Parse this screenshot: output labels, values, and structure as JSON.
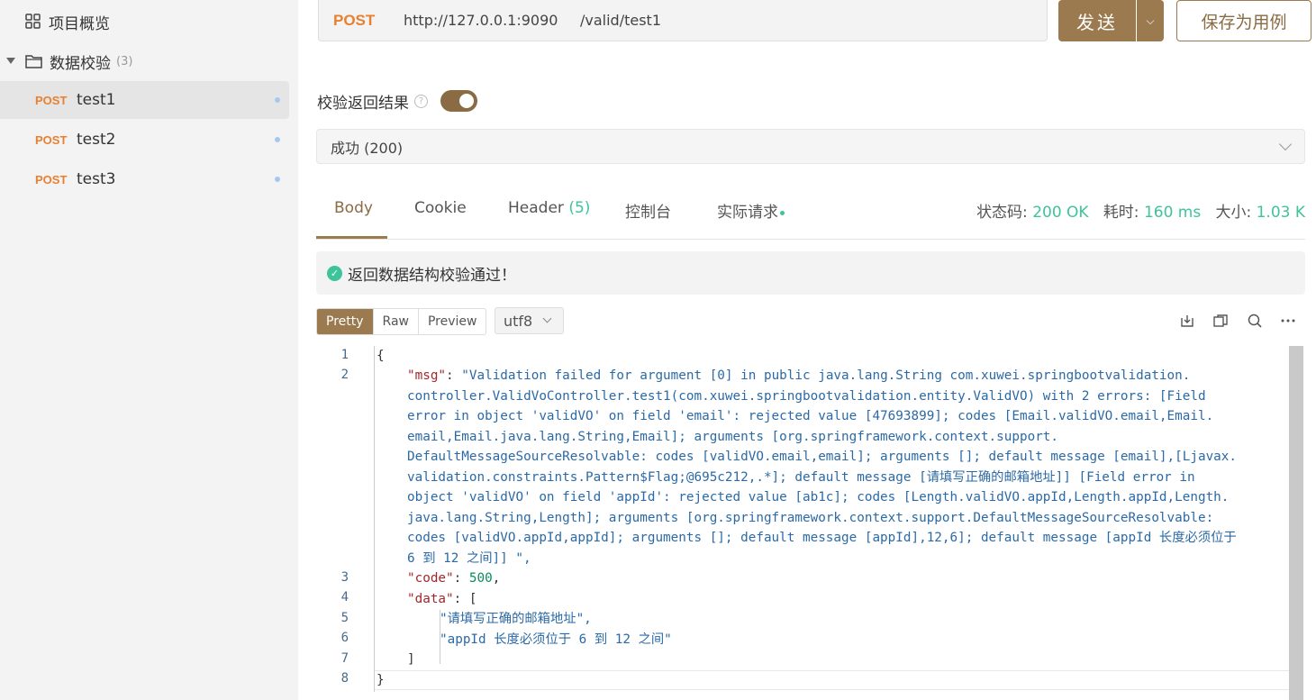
{
  "sidebar": {
    "overview_label": "项目概览",
    "folder_label": "数据校验",
    "folder_count": "(3)",
    "items": [
      {
        "method": "POST",
        "label": "test1"
      },
      {
        "method": "POST",
        "label": "test2"
      },
      {
        "method": "POST",
        "label": "test3"
      }
    ]
  },
  "request": {
    "method": "POST",
    "host": "http://127.0.0.1:9090",
    "path": "/valid/test1",
    "send_label": "发送",
    "save_label": "保存为用例"
  },
  "validation": {
    "label": "校验返回结果",
    "enabled": true,
    "status_option": "成功 (200)",
    "banner": "返回数据结构校验通过！"
  },
  "tabs": {
    "body": "Body",
    "cookie": "Cookie",
    "header": "Header",
    "header_count": "(5)",
    "console": "控制台",
    "actual": "实际请求"
  },
  "stats": {
    "status_label": "状态码:",
    "status_value": "200 OK",
    "time_label": "耗时:",
    "time_value": "160 ms",
    "size_label": "大小:",
    "size_value": "1.03 K"
  },
  "viewer": {
    "modes": [
      "Pretty",
      "Raw",
      "Preview"
    ],
    "encoding": "utf8"
  },
  "code": {
    "line_numbers": [
      "1",
      "2",
      "3",
      "4",
      "5",
      "6",
      "7",
      "8"
    ],
    "l1": "{",
    "msg_key": "\"msg\"",
    "msg_lines": [
      "\"Validation failed for argument [0] in public java.lang.String com.xuwei.springbootvalidation.",
      "controller.ValidVoController.test1(com.xuwei.springbootvalidation.entity.ValidVO) with 2 errors: [Field",
      "error in object 'validVO' on field 'email': rejected value [47693899]; codes [Email.validVO.email,Email.",
      "email,Email.java.lang.String,Email]; arguments [org.springframework.context.support.",
      "DefaultMessageSourceResolvable: codes [validVO.email,email]; arguments []; default message [email],[Ljavax.",
      "validation.constraints.Pattern$Flag;@695c212,.*]; default message [请填写正确的邮箱地址]] [Field error in",
      "object 'validVO' on field 'appId': rejected value [ab1c]; codes [Length.validVO.appId,Length.appId,Length.",
      "java.lang.String,Length]; arguments [org.springframework.context.support.DefaultMessageSourceResolvable:",
      "codes [validVO.appId,appId]; arguments []; default message [appId],12,6]; default message [appId 长度必须位于",
      "6 到 12 之间]] \","
    ],
    "code_key": "\"code\"",
    "code_value": "500",
    "data_key": "\"data\"",
    "data_items": [
      "\"请填写正确的邮箱地址\",",
      "\"appId 长度必须位于 6 到 12 之间\""
    ],
    "l7": "]",
    "l8": "}"
  }
}
